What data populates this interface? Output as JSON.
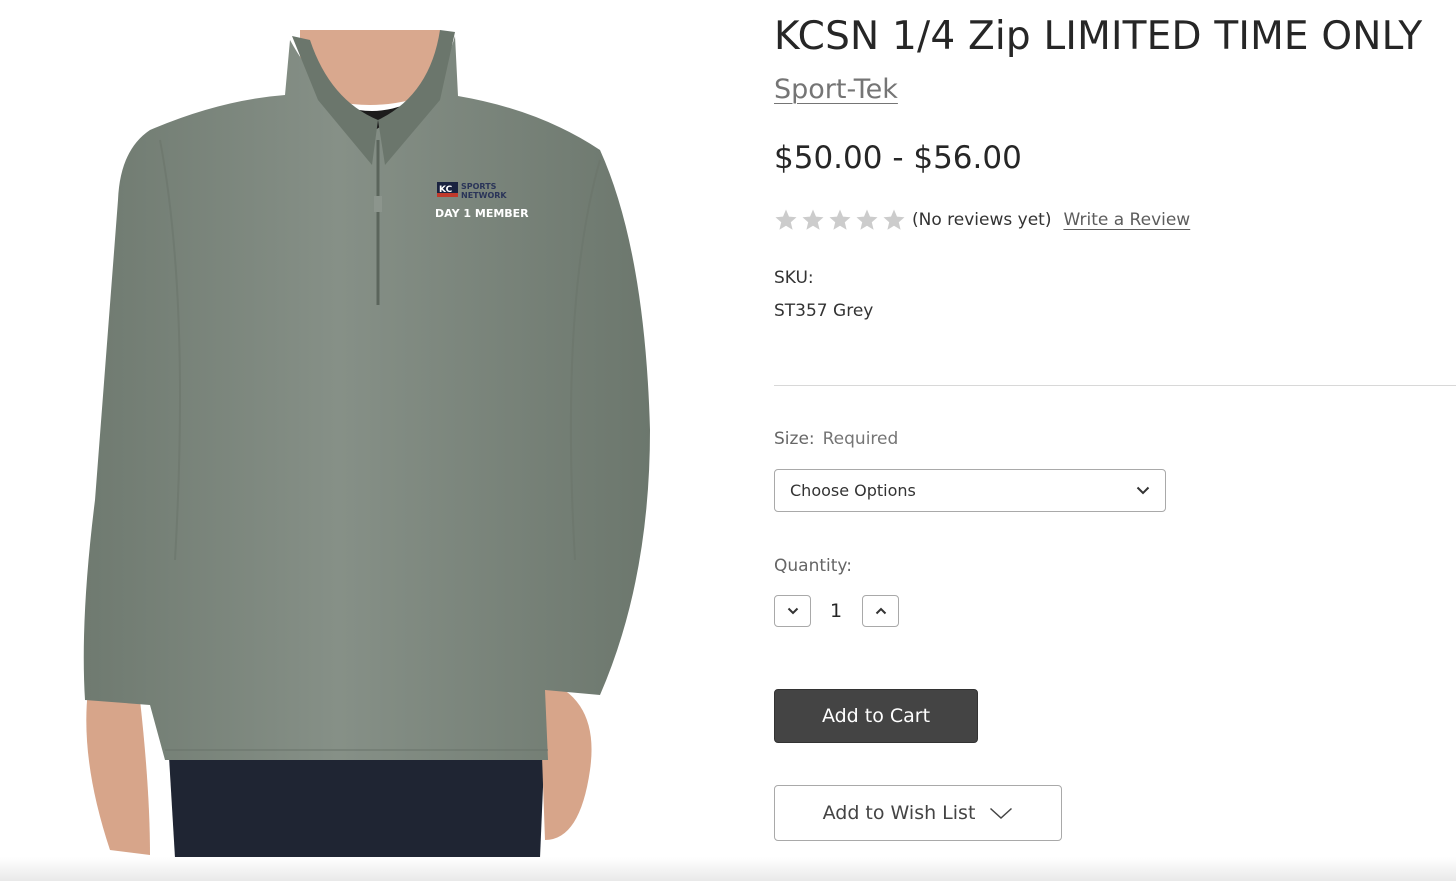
{
  "product": {
    "title": "KCSN 1/4 Zip LIMITED TIME ONLY",
    "brand": "Sport-Tek",
    "price_range": "$50.00 - $56.00",
    "rating": {
      "stars_filled": 0,
      "stars_total": 5,
      "no_reviews_text": "(No reviews yet)",
      "write_review_label": "Write a Review"
    },
    "sku": {
      "label": "SKU:",
      "value": "ST357 Grey"
    },
    "image": {
      "logo_line1": "KC",
      "logo_line2": "SPORTS",
      "logo_line3": "NETWORK",
      "logo_line4": "DAY 1 MEMBER",
      "shirt_color": "#7f8a80"
    }
  },
  "options": {
    "size": {
      "label": "Size:",
      "required": "Required",
      "selected": "Choose Options",
      "icon": "chevron-down-icon"
    }
  },
  "quantity": {
    "label": "Quantity:",
    "value": "1",
    "decrement_icon": "chevron-down-icon",
    "increment_icon": "chevron-up-icon"
  },
  "actions": {
    "add_to_cart": "Add to Cart",
    "add_to_wishlist": "Add to Wish List",
    "wishlist_icon": "chevron-down-icon"
  },
  "colors": {
    "primary_button": "#444444",
    "star_empty": "#cccccc"
  }
}
